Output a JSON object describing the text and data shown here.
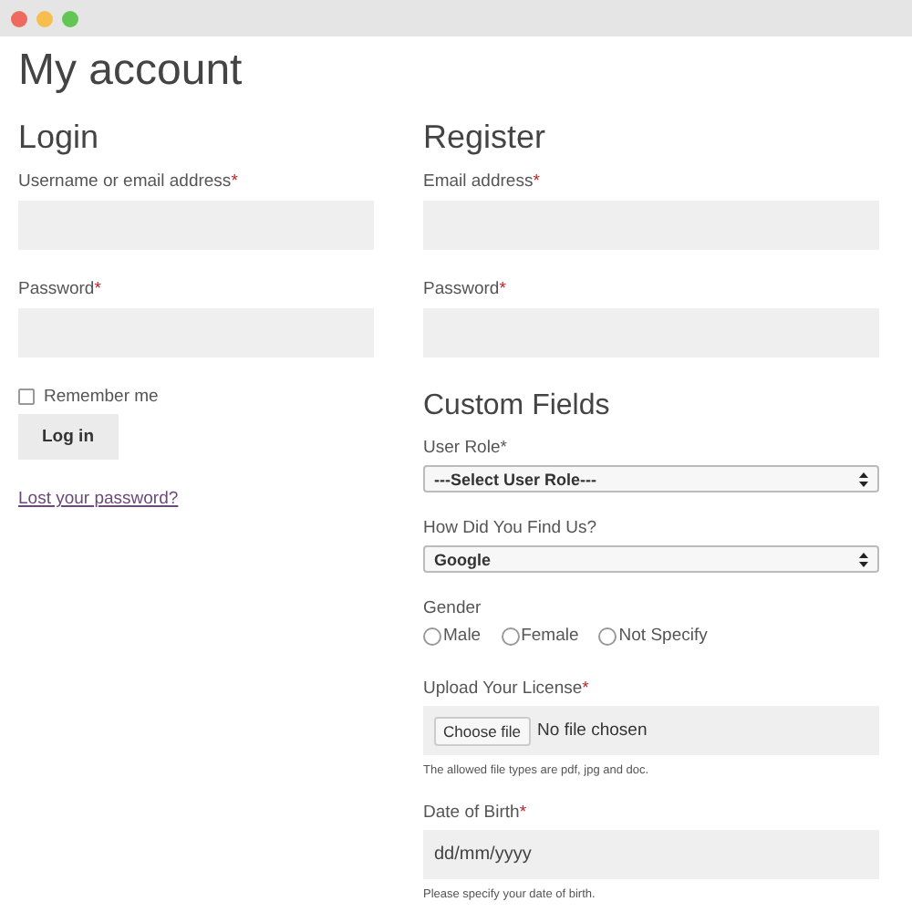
{
  "window": {
    "controls": [
      {
        "color": "#ee6a5f"
      },
      {
        "color": "#f5be4f"
      },
      {
        "color": "#62c554"
      }
    ]
  },
  "title": "My account",
  "login": {
    "heading": "Login",
    "fields": [
      {
        "label": "Username or email address",
        "mark": "*"
      },
      {
        "label": "Password",
        "mark": "*"
      }
    ],
    "remember": {
      "label": "Remember me",
      "checked": false
    },
    "button": "Log in",
    "link": "Lost your password?"
  },
  "register": {
    "heading": "Register",
    "fields": [
      {
        "label": "Email address",
        "mark": "*"
      },
      {
        "label": "Password",
        "mark": "*"
      }
    ],
    "custom_heading": "Custom Fields",
    "custom": [
      {
        "kind": "select",
        "label": "User Role*",
        "value": "---Select User Role---"
      },
      {
        "kind": "select",
        "label": "How Did You Find Us?",
        "value": "Google"
      },
      {
        "kind": "radio",
        "label": "Gender",
        "options": [
          {
            "label": "Male",
            "selected": false
          },
          {
            "label": "Female",
            "selected": false
          },
          {
            "label": "Not Specify",
            "selected": false
          }
        ]
      },
      {
        "kind": "file",
        "label": "Upload Your License",
        "mark": "*",
        "button": "Choose file",
        "value": "No file chosen",
        "note": "The allowed file types are pdf, jpg and doc."
      },
      {
        "kind": "date",
        "label": "Date of Birth",
        "mark": "*",
        "placeholder": "dd/mm/yyyy",
        "note": "Please specify your date of birth."
      }
    ]
  }
}
